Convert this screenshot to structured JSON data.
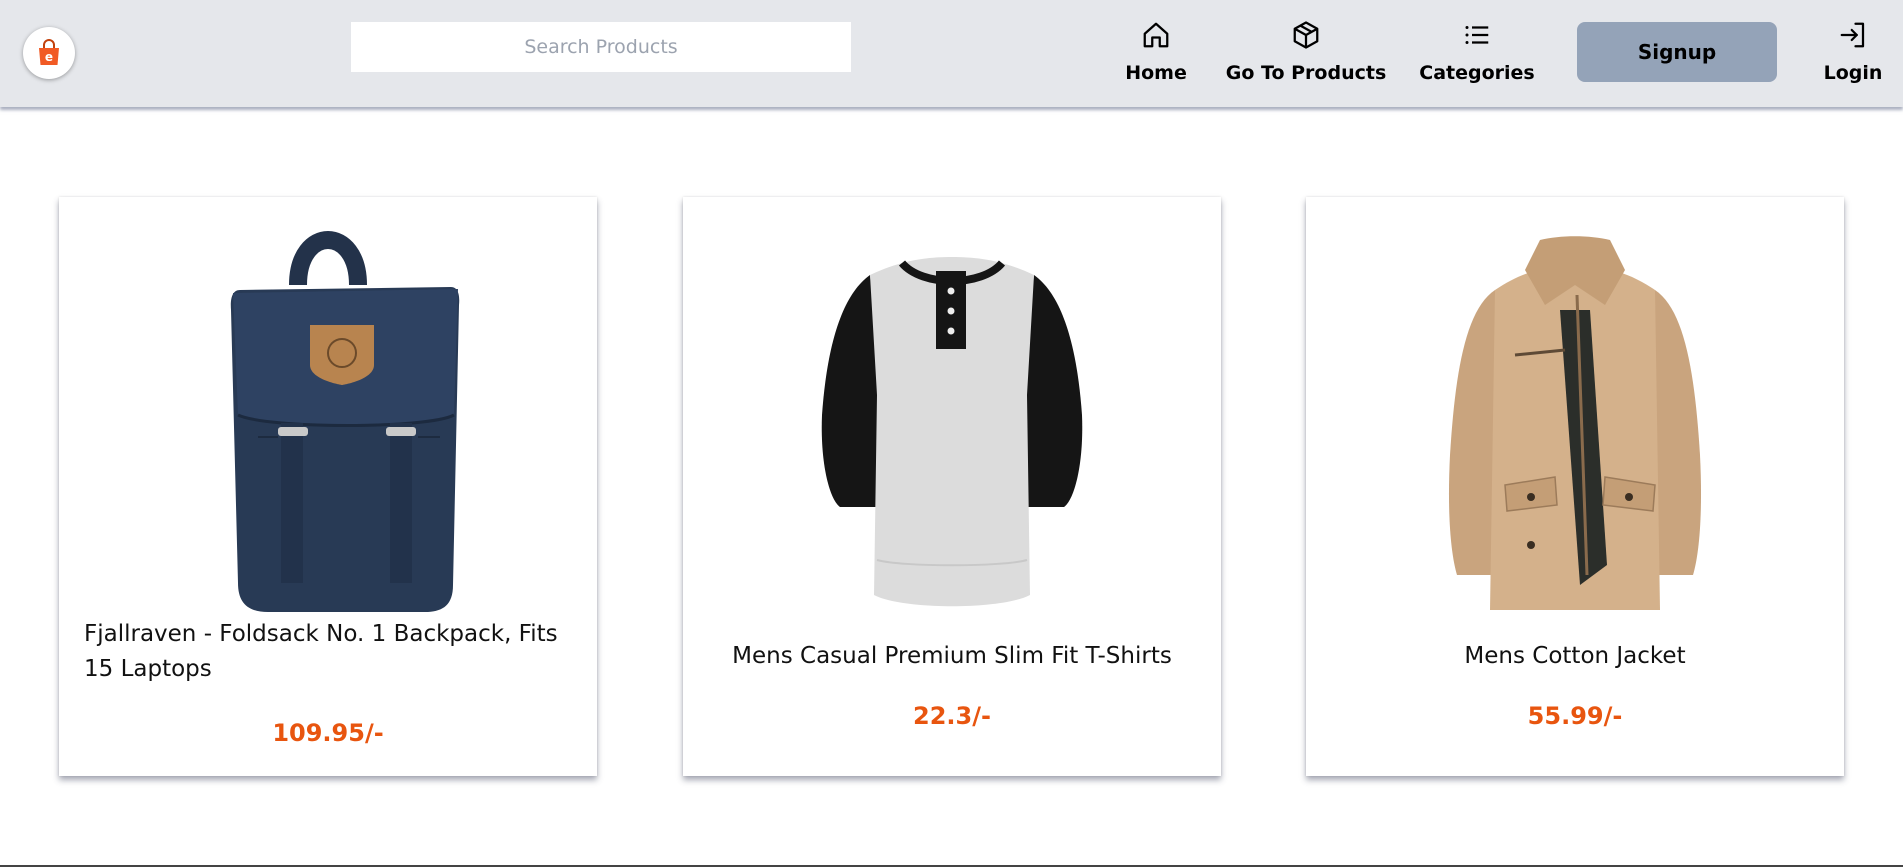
{
  "header": {
    "search_placeholder": "Search Products",
    "nav": {
      "home": "Home",
      "products": "Go To Products",
      "categories": "Categories",
      "signup": "Signup",
      "login": "Login"
    },
    "logo_icon": "shopping-bag-icon",
    "logo_letter": "e"
  },
  "products": [
    {
      "title": "Fjallraven - Foldsack No. 1 Backpack, Fits 15 Laptops",
      "price": "109.95/-"
    },
    {
      "title": "Mens Casual Premium Slim Fit T-Shirts",
      "price": "22.3/-"
    },
    {
      "title": "Mens Cotton Jacket",
      "price": "55.99/-"
    }
  ],
  "colors": {
    "header_bg": "#e5e7eb",
    "signup_bg": "#94a3b8",
    "price": "#e8550f",
    "logo_bag": "#f15a24"
  }
}
